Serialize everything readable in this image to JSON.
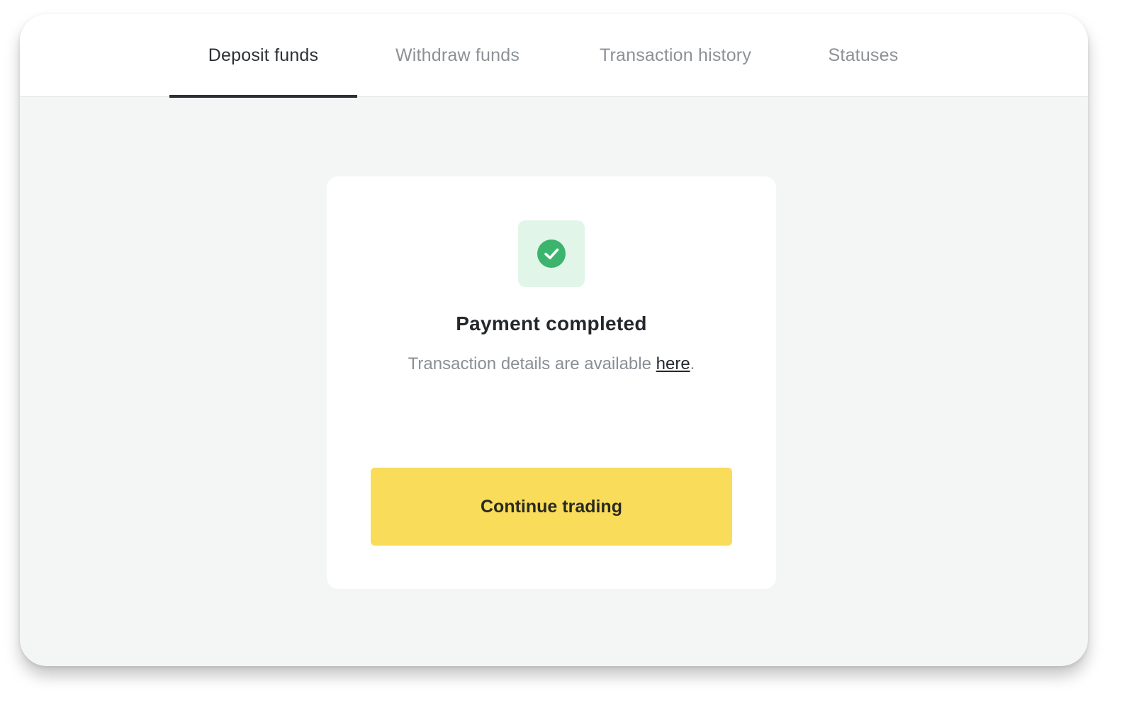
{
  "tabs": [
    {
      "label": "Deposit funds",
      "active": true
    },
    {
      "label": "Withdraw funds",
      "active": false
    },
    {
      "label": "Transaction history",
      "active": false
    },
    {
      "label": "Statuses",
      "active": false
    }
  ],
  "status": {
    "icon": "check-circle-icon",
    "title": "Payment completed",
    "message_prefix": "Transaction details are available ",
    "link_label": "here",
    "message_suffix": "."
  },
  "actions": {
    "continue_label": "Continue trading"
  },
  "colors": {
    "accent_yellow": "#f8dc5a",
    "success_green": "#3cb46e",
    "success_bg": "#e1f6e8",
    "active_tab": "#2c3136"
  }
}
